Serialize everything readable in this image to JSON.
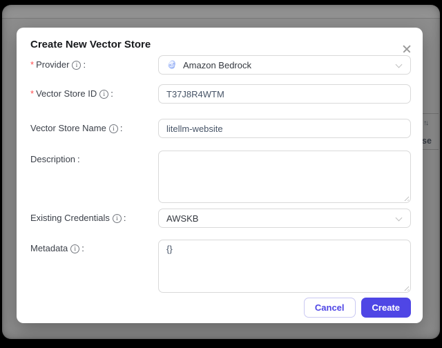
{
  "ui": {
    "colon": ":",
    "required_mark": "*"
  },
  "modal": {
    "title": "Create New Vector Store",
    "fields": [
      {
        "label": "Provider",
        "required": true,
        "info": true,
        "type": "select",
        "value": "Amazon Bedrock",
        "icon": "amazon-bedrock-icon"
      },
      {
        "label": "Vector Store ID",
        "required": true,
        "info": true,
        "type": "input",
        "value": "T37J8R4WTM"
      },
      {
        "label": "Vector Store Name",
        "required": false,
        "info": true,
        "type": "input",
        "value": "litellm-website"
      },
      {
        "label": "Description",
        "required": false,
        "info": false,
        "type": "textarea",
        "value": ""
      },
      {
        "label": "Existing Credentials",
        "required": false,
        "info": true,
        "type": "select",
        "value": "AWSKB"
      },
      {
        "label": "Metadata",
        "required": false,
        "info": true,
        "type": "textarea",
        "value": "{}"
      }
    ],
    "footer": {
      "cancel_label": "Cancel",
      "create_label": "Create"
    }
  },
  "background": {
    "sort_icon": "↑↓",
    "partial_text": "se"
  },
  "colors": {
    "accent": "#4f46e5",
    "required": "#ff4d4f",
    "border": "#d9d9d9",
    "backdrop": "#8d8d8d",
    "page_behind": "#000000"
  }
}
